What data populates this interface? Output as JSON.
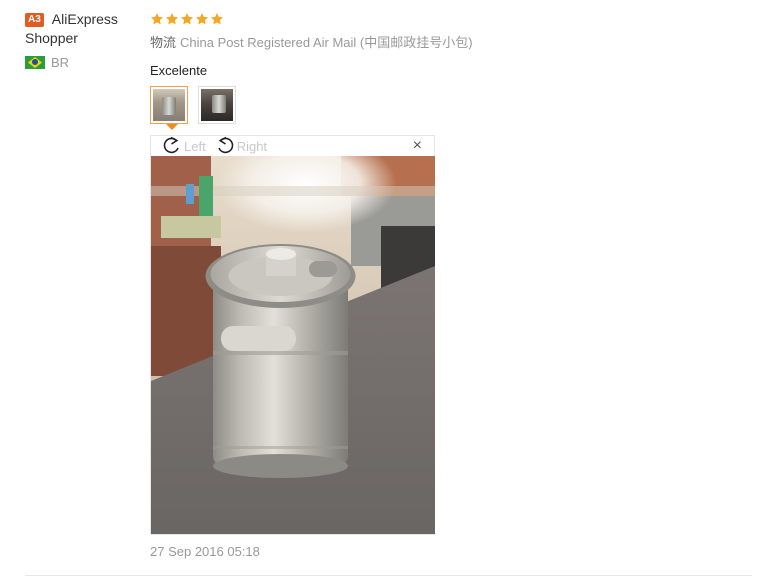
{
  "user": {
    "level_badge": "A3",
    "name_line1": "AliExpress",
    "name_line2": "Shopper",
    "country_code": "BR",
    "flag": "brazil-flag"
  },
  "review": {
    "rating": 5,
    "star_color": "#f5a623",
    "shipping_label": "物流",
    "shipping_method": "China Post Registered Air Mail (中国邮政挂号小包)",
    "feedback_text": "Excelente",
    "thumbnails": [
      {
        "name": "keg-photo-1",
        "selected": true
      },
      {
        "name": "keg-photo-2",
        "selected": false
      }
    ],
    "viewer": {
      "rotate_left_label": "Left",
      "rotate_right_label": "Right",
      "close_glyph": "×"
    },
    "date": "27 Sep 2016 05:18"
  }
}
